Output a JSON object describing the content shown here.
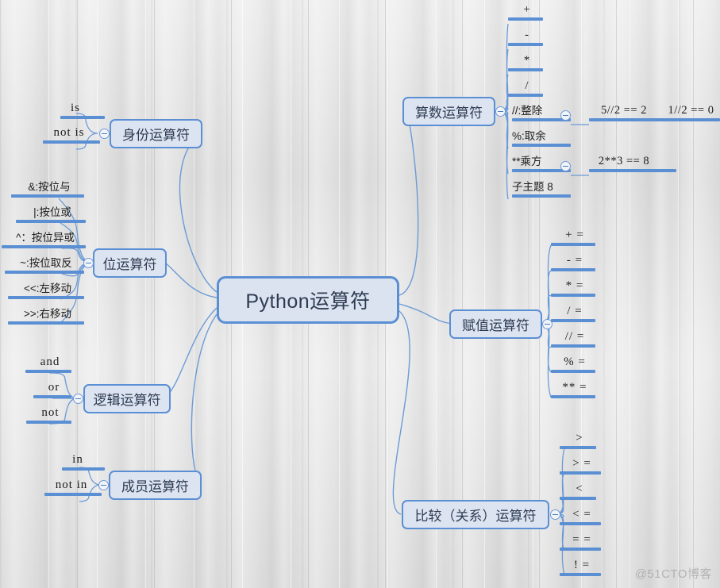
{
  "watermark": "@51CTO博客",
  "root": {
    "label": "Python运算符"
  },
  "branches": [
    {
      "id": "identity",
      "label": "身份运算符"
    },
    {
      "id": "bitwise",
      "label": "位运算符"
    },
    {
      "id": "logical",
      "label": "逻辑运算符"
    },
    {
      "id": "membership",
      "label": "成员运算符"
    },
    {
      "id": "arithmetic",
      "label": "算数运算符"
    },
    {
      "id": "assignment",
      "label": "赋值运算符"
    },
    {
      "id": "comparison",
      "label": "比较（关系）运算符"
    }
  ],
  "identity_items": [
    "is",
    "not is"
  ],
  "bitwise_items": [
    "&:按位与",
    "|:按位或",
    "^：按位异或",
    "~:按位取反",
    "<<:左移动",
    ">>:右移动"
  ],
  "logical_items": [
    "and",
    "or",
    "not"
  ],
  "membership_items": [
    "in",
    "not in"
  ],
  "arithmetic_items": [
    "+",
    "-",
    "*",
    "/",
    "//:整除",
    "%:取余",
    "**乘方",
    "子主题 8"
  ],
  "arithmetic_examples": {
    "floordiv": [
      "5//2 == 2",
      "1//2 == 0"
    ],
    "power": [
      "2**3 == 8"
    ]
  },
  "assignment_items": [
    "+ =",
    "- =",
    "* =",
    "/ =",
    "// =",
    "% =",
    "** ="
  ],
  "comparison_items": [
    ">",
    "> =",
    "<",
    "< =",
    "= =",
    "! ="
  ],
  "colors": {
    "node_fill": "#dde4f1",
    "node_border": "#5b8fd4",
    "link": "#6b9bd6",
    "rule": "#5b8fd4",
    "text": "#2d3b52",
    "background": "#e4e4e4"
  }
}
